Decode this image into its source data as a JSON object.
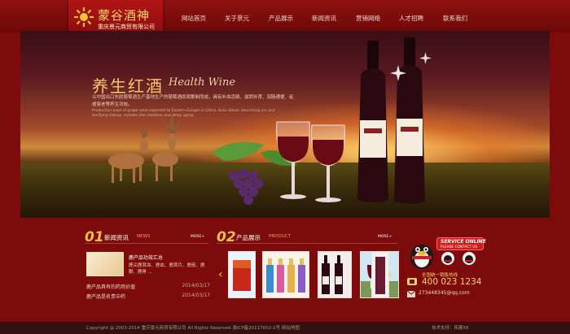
{
  "brand": {
    "name": "蒙谷酒神",
    "company": "重庆景元商贸有限公司"
  },
  "nav": {
    "items": [
      "网站首页",
      "关于景元",
      "产品展示",
      "新闻资讯",
      "营销网络",
      "人才招聘",
      "联系我们"
    ]
  },
  "banner": {
    "title": "养生红酒",
    "title_en": "Health Wine",
    "desc": "以中国出口东欧葡萄酒生产基地生产的葡萄酒原浆酿制而成，具有补血活络、滋阴补肾、润肠通便、延缓衰老等养生功效。",
    "desc_en": "Production base of grape wine exported to Eastern Europe in China, tonic blood, nourishing yin and tonifying kidney, moisten the intestine and delay aging."
  },
  "news": {
    "num": "01",
    "title": "新闻资讯",
    "title_en": "NEWS",
    "more": "MORE+",
    "feature_title": "鹿产品功效汇总",
    "feature_desc": "鹿尖鹿茸血、鹿血、鹿茸片、鹿筋、鹿鞭、鹿骨 ...",
    "items": [
      {
        "title": "鹿产品具有的药用价值",
        "date": "2014/03/17"
      },
      {
        "title": "鹿产品是名贵中药",
        "date": "2014/03/17"
      }
    ]
  },
  "products": {
    "num": "02",
    "title": "产品展示",
    "title_en": "PRODUCT",
    "more": "MORE+",
    "prev_icon": "chevron-left-icon",
    "next_icon": "chevron-right-icon",
    "items": [
      "product-1",
      "product-2",
      "product-3",
      "product-4",
      "product-5"
    ]
  },
  "contact": {
    "service_title": "SERVICE ONLINE",
    "service_sub": "PLEASE CONTACT US",
    "tel_label": "全国统一销售热线",
    "tel": "400 023 1234",
    "email": "273448345@qq.com"
  },
  "footer": {
    "copyright": "Copyright @ 2003-2014 重庆景元商贸有限公司 All Rights Reserved    渝ICP备20117602-1号    网站地图",
    "tech": "技术支持：拓展58"
  },
  "colors": {
    "brand_red": "#7d0b0b",
    "accent_gold": "#f4c044"
  }
}
